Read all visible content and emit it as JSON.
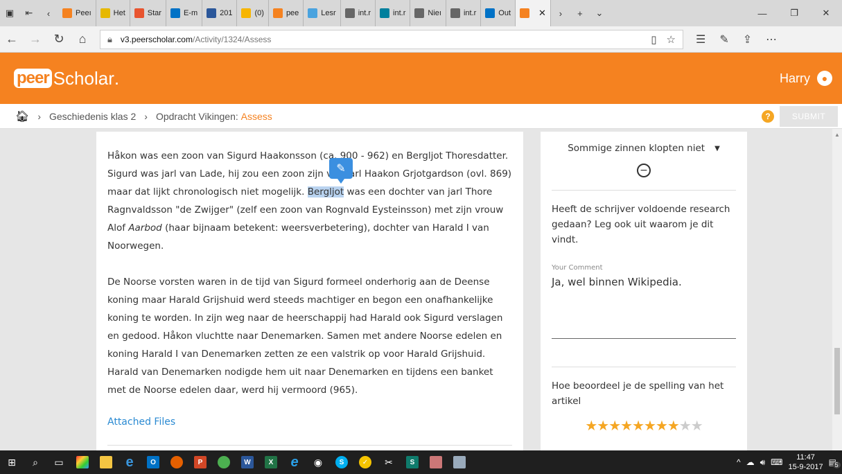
{
  "tabs": [
    {
      "label": "Peeı",
      "color": "#f58220"
    },
    {
      "label": "Het",
      "color": "#e6b800"
    },
    {
      "label": "Star",
      "color": "#e8542f"
    },
    {
      "label": "E-m",
      "color": "#0072c6"
    },
    {
      "label": "201",
      "color": "#2b579a"
    },
    {
      "label": "(0)",
      "color": "#f7b500"
    },
    {
      "label": "pee",
      "color": "#f58220"
    },
    {
      "label": "Lesr",
      "color": "#4aa3df"
    },
    {
      "label": "int.r",
      "color": "#666666"
    },
    {
      "label": "int.r",
      "color": "#00809d"
    },
    {
      "label": "Nieı",
      "color": "#666666"
    },
    {
      "label": "int.r",
      "color": "#666666"
    },
    {
      "label": "Out",
      "color": "#0072c6"
    }
  ],
  "active_tab": {
    "color": "#f58220"
  },
  "url": {
    "host": "v3.peerscholar.com",
    "path": "/Activity/1324/Assess"
  },
  "app": {
    "logo_peer": "peer",
    "logo_scholar": "Scholar",
    "user_name": "Harry"
  },
  "breadcrumb": {
    "course": "Geschiedenis klas 2",
    "assignment": "Opdracht Vikingen:",
    "stage": "Assess",
    "submit": "SUBMIT"
  },
  "article": {
    "p1_a": "Håkon was een zoon van Sigurd Haakonsson (ca. 900 - 962) en Bergljot Thoresdatter. Sigurd was jarl van Lade, hij zou een zoon zijn van jarl Haakon Grjotgardson (ovl. 869) maar dat lijkt chronologisch niet mogelijk.",
    "p1_sel": "Bergljot",
    "p1_b": "was een dochter van jarl Thore Ragnvaldsson \"de Zwijger\" (zelf een zoon van Rognvald Eysteinsson) met zijn vrouw Alof",
    "p1_italic": "Aarbod",
    "p1_c": "(haar bijnaam betekent: weersverbetering), dochter van Harald I van Noorwegen.",
    "p2": "De Noorse vorsten waren in de tijd van Sigurd formeel onderhorig aan de Deense koning maar Harald Grijshuid werd steeds machtiger en begon een onafhankelijke koning te worden. In zijn weg naar de heerschappij had Harald ook Sigurd verslagen en gedood. Håkon vluchtte naar Denemarken. Samen met andere Noorse edelen en koning Harald I van Denemarken zetten ze een valstrik op voor Harald Grijshuid. Harald van Denemarken nodigde hem uit naar Denemarken en tijdens een banket met de Noorse edelen daar, werd hij vermoord (965).",
    "attached": "Attached Files"
  },
  "panel": {
    "dropdown": "Sommige zinnen klopten niet",
    "question1": "Heeft de schrijver voldoende research gedaan? Leg ook uit waarom je dit vindt.",
    "comment_label": "Your Comment",
    "comment_value": "Ja, wel binnen Wikipedia.",
    "question2": "Hoe beoordeel je de spelling van het artikel",
    "rating": 8,
    "rating_max": 10
  },
  "taskbar": {
    "time": "11:47",
    "date": "15-9-2017",
    "notif_count": "5"
  }
}
